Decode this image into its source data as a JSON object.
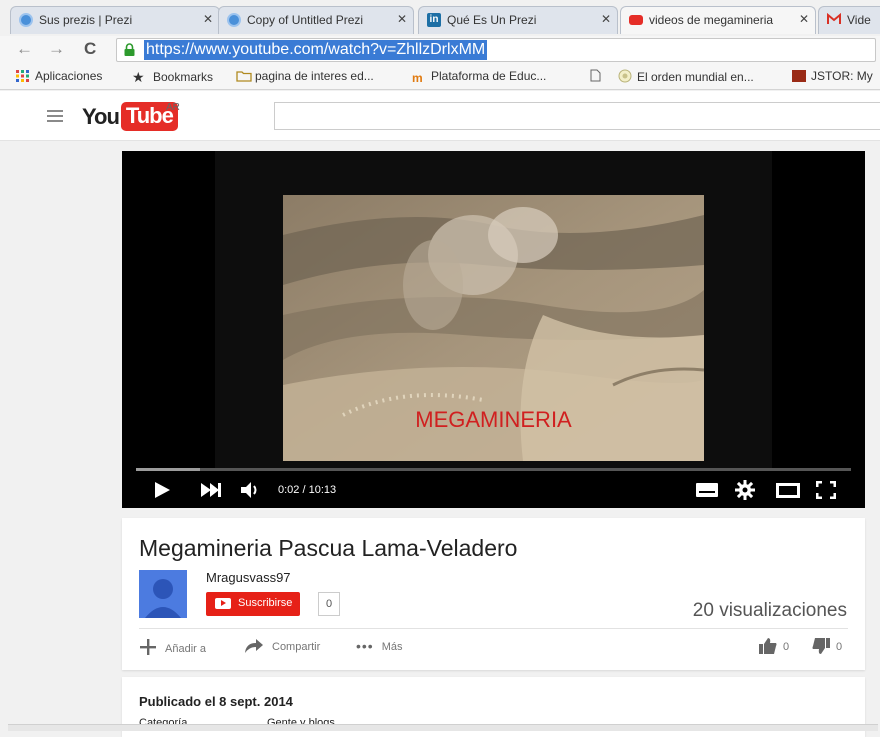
{
  "browser": {
    "tabs": [
      {
        "label": "Sus prezis | Prezi",
        "icon": "prezi-icon"
      },
      {
        "label": "Copy of Untitled Prezi",
        "icon": "prezi-icon"
      },
      {
        "label": "Qué Es Un Prezi",
        "icon": "linkedin-icon"
      },
      {
        "label": "videos de megamineria",
        "icon": "youtube-icon"
      },
      {
        "label": "Vide",
        "icon": "gmail-icon"
      }
    ],
    "url": "https://www.youtube.com/watch?v=ZhllzDrlxMM",
    "bookmarks": [
      {
        "label": "Aplicaciones",
        "icon": "apps-grid-icon"
      },
      {
        "label": "Bookmarks",
        "icon": "star-icon"
      },
      {
        "label": "pagina de interes ed...",
        "icon": "folder-icon"
      },
      {
        "label": "Plataforma de Educ...",
        "icon": "moodle-icon"
      },
      {
        "label": "",
        "icon": "page-icon"
      },
      {
        "label": "El orden mundial en...",
        "icon": "globe-icon"
      },
      {
        "label": "JSTOR: My",
        "icon": "jstor-icon"
      }
    ]
  },
  "youtube": {
    "logo_you": "You",
    "logo_tube": "Tube",
    "country": "AR"
  },
  "player": {
    "caption": "MEGAMINERIA",
    "time": "0:02 / 10:13",
    "progress": 0.09
  },
  "video": {
    "title": "Megamineria Pascua Lama-Veladero",
    "channel": "Mragusvass97",
    "subscribe_label": "Suscribirse",
    "subscriber_count": "0",
    "views": "20 visualizaciones",
    "actions": {
      "add": "Añadir a",
      "share": "Compartir",
      "more": "Más"
    },
    "likes": "0",
    "dislikes": "0"
  },
  "details": {
    "published": "Publicado el 8 sept. 2014",
    "category_label": "Categoría",
    "category_value": "Gente y blogs"
  },
  "colors": {
    "youtube_red": "#e52d27",
    "subscribe_red": "#e62117",
    "url_highlight": "#3a7bd5"
  }
}
